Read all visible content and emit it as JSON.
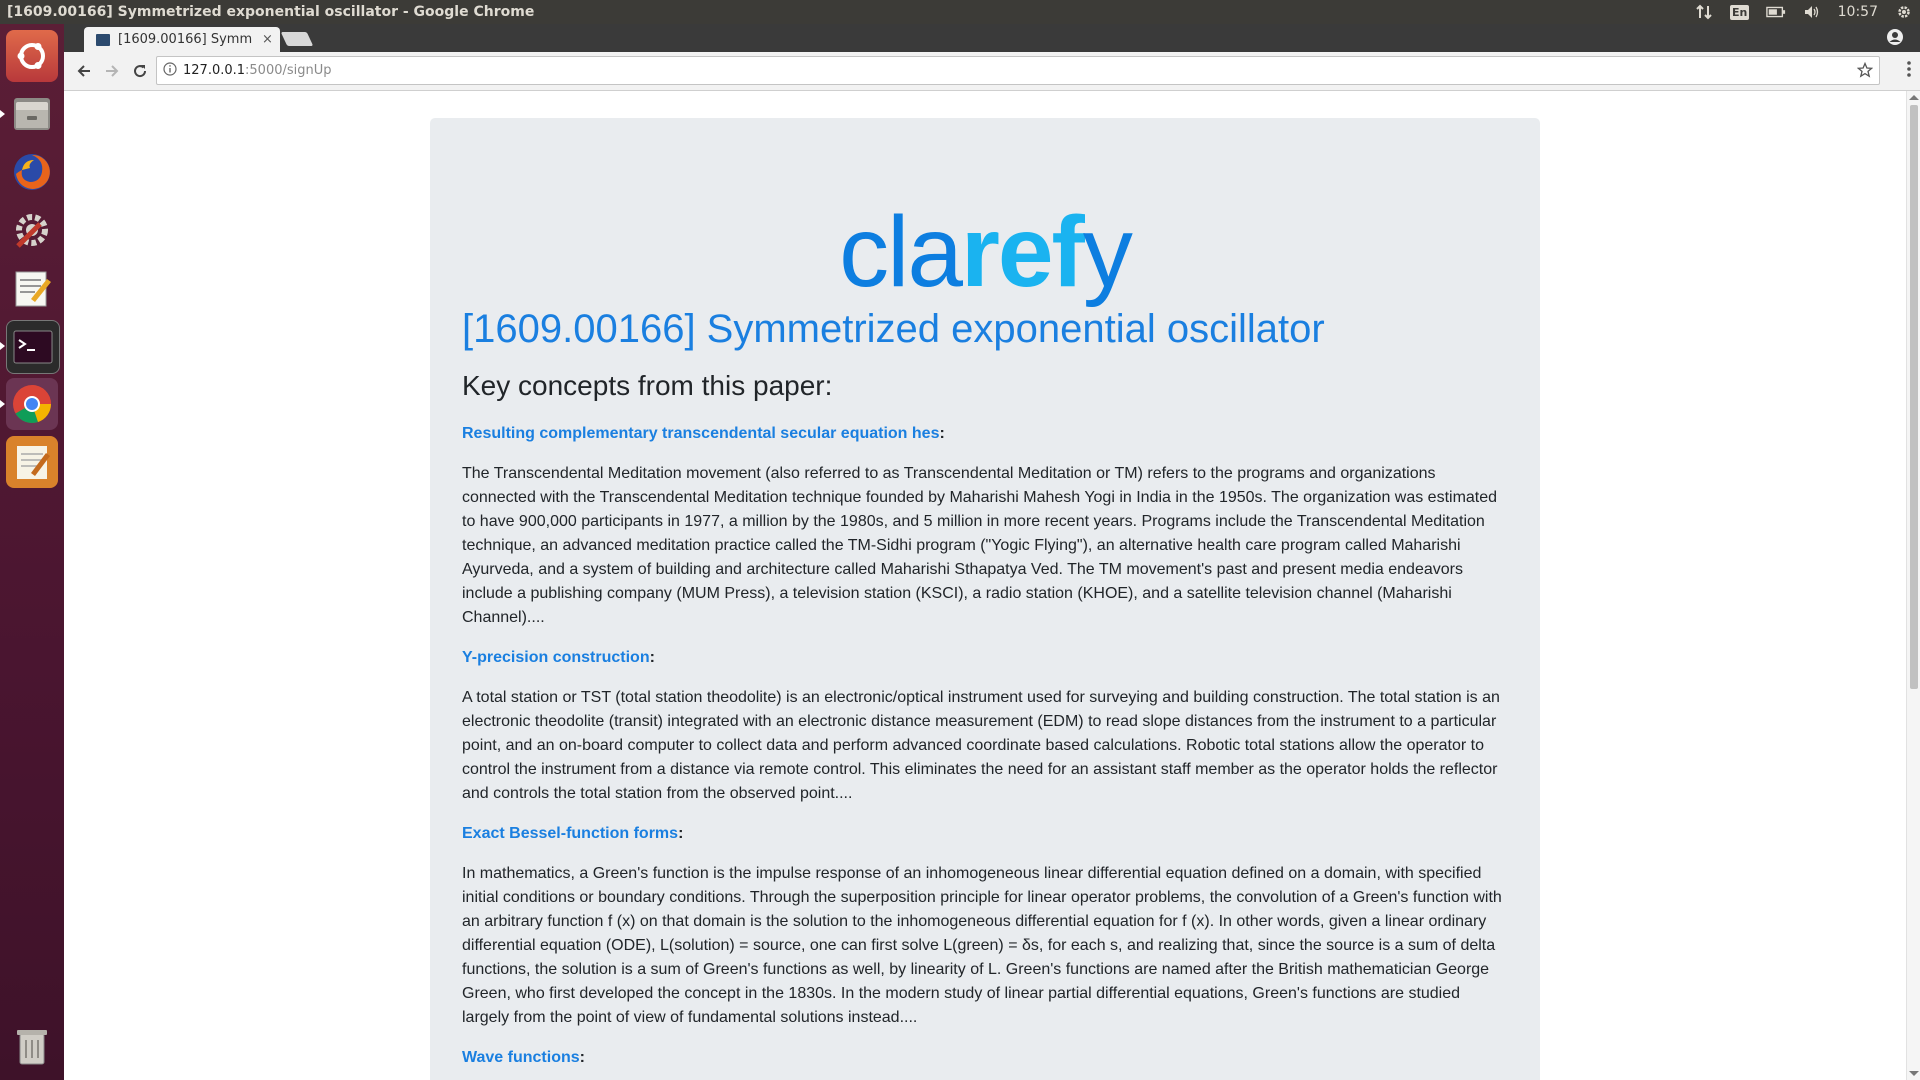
{
  "system": {
    "window_title": "[1609.00166] Symmetrized exponential oscillator - Google Chrome",
    "keyboard_layout": "En",
    "clock": "10:57"
  },
  "launcher": {
    "items": [
      "ubuntu-dash-icon",
      "files-icon",
      "firefox-icon",
      "system-settings-icon",
      "text-editor-icon",
      "terminal-icon",
      "chrome-icon",
      "notes-icon",
      "trash-icon"
    ]
  },
  "browser": {
    "tab_title": "[1609.00166] Symm",
    "tab_close": "×",
    "url_host": "127.0.0.1",
    "url_path": ":5000/signUp"
  },
  "page": {
    "logo": {
      "part1": "cla",
      "part2": "ref",
      "part3": "y"
    },
    "paper_title": "[1609.00166] Symmetrized exponential oscillator",
    "concepts_heading": "Key concepts from this paper:",
    "concepts": [
      {
        "title": "Resulting complementary transcendental secular equation hes",
        "body": "The Transcendental Meditation movement (also referred to as Transcendental Meditation or TM) refers to the programs and organizations connected with the Transcendental Meditation technique founded by Maharishi Mahesh Yogi in India in the 1950s. The organization was estimated to have 900,000 participants in 1977, a million by the 1980s, and 5 million in more recent years. Programs include the Transcendental Meditation technique, an advanced meditation practice called the TM-Sidhi program (\"Yogic Flying\"), an alternative health care program called Maharishi Ayurveda, and a system of building and architecture called Maharishi Sthapatya Ved. The TM movement's past and present media endeavors include a publishing company (MUM Press), a television station (KSCI), a radio station (KHOE), and a satellite television channel (Maharishi Channel)...."
      },
      {
        "title": "Y-precision construction",
        "body": "A total station or TST (total station theodolite) is an electronic/optical instrument used for surveying and building construction. The total station is an electronic theodolite (transit) integrated with an electronic distance measurement (EDM) to read slope distances from the instrument to a particular point, and an on-board computer to collect data and perform advanced coordinate based calculations. Robotic total stations allow the operator to control the instrument from a distance via remote control. This eliminates the need for an assistant staff member as the operator holds the reflector and controls the total station from the observed point...."
      },
      {
        "title": "Exact Bessel-function forms",
        "body": "In mathematics, a Green's function is the impulse response of an inhomogeneous linear differential equation defined on a domain, with specified initial conditions or boundary conditions. Through the superposition principle for linear operator problems, the convolution of a Green's function with an arbitrary function f (x) on that domain is the solution to the inhomogeneous differential equation for f (x). In other words, given a linear ordinary differential equation (ODE), L(solution) = source, one can first solve L(green) = δs, for each s, and realizing that, since the source is a sum of delta functions, the solution is a sum of Green's functions as well, by linearity of L. Green's functions are named after the British mathematician George Green, who first developed the concept in the 1830s. In the modern study of linear partial differential equations, Green's functions are studied largely from the point of view of fundamental solutions instead...."
      },
      {
        "title": "Wave functions",
        "body": ""
      }
    ]
  }
}
